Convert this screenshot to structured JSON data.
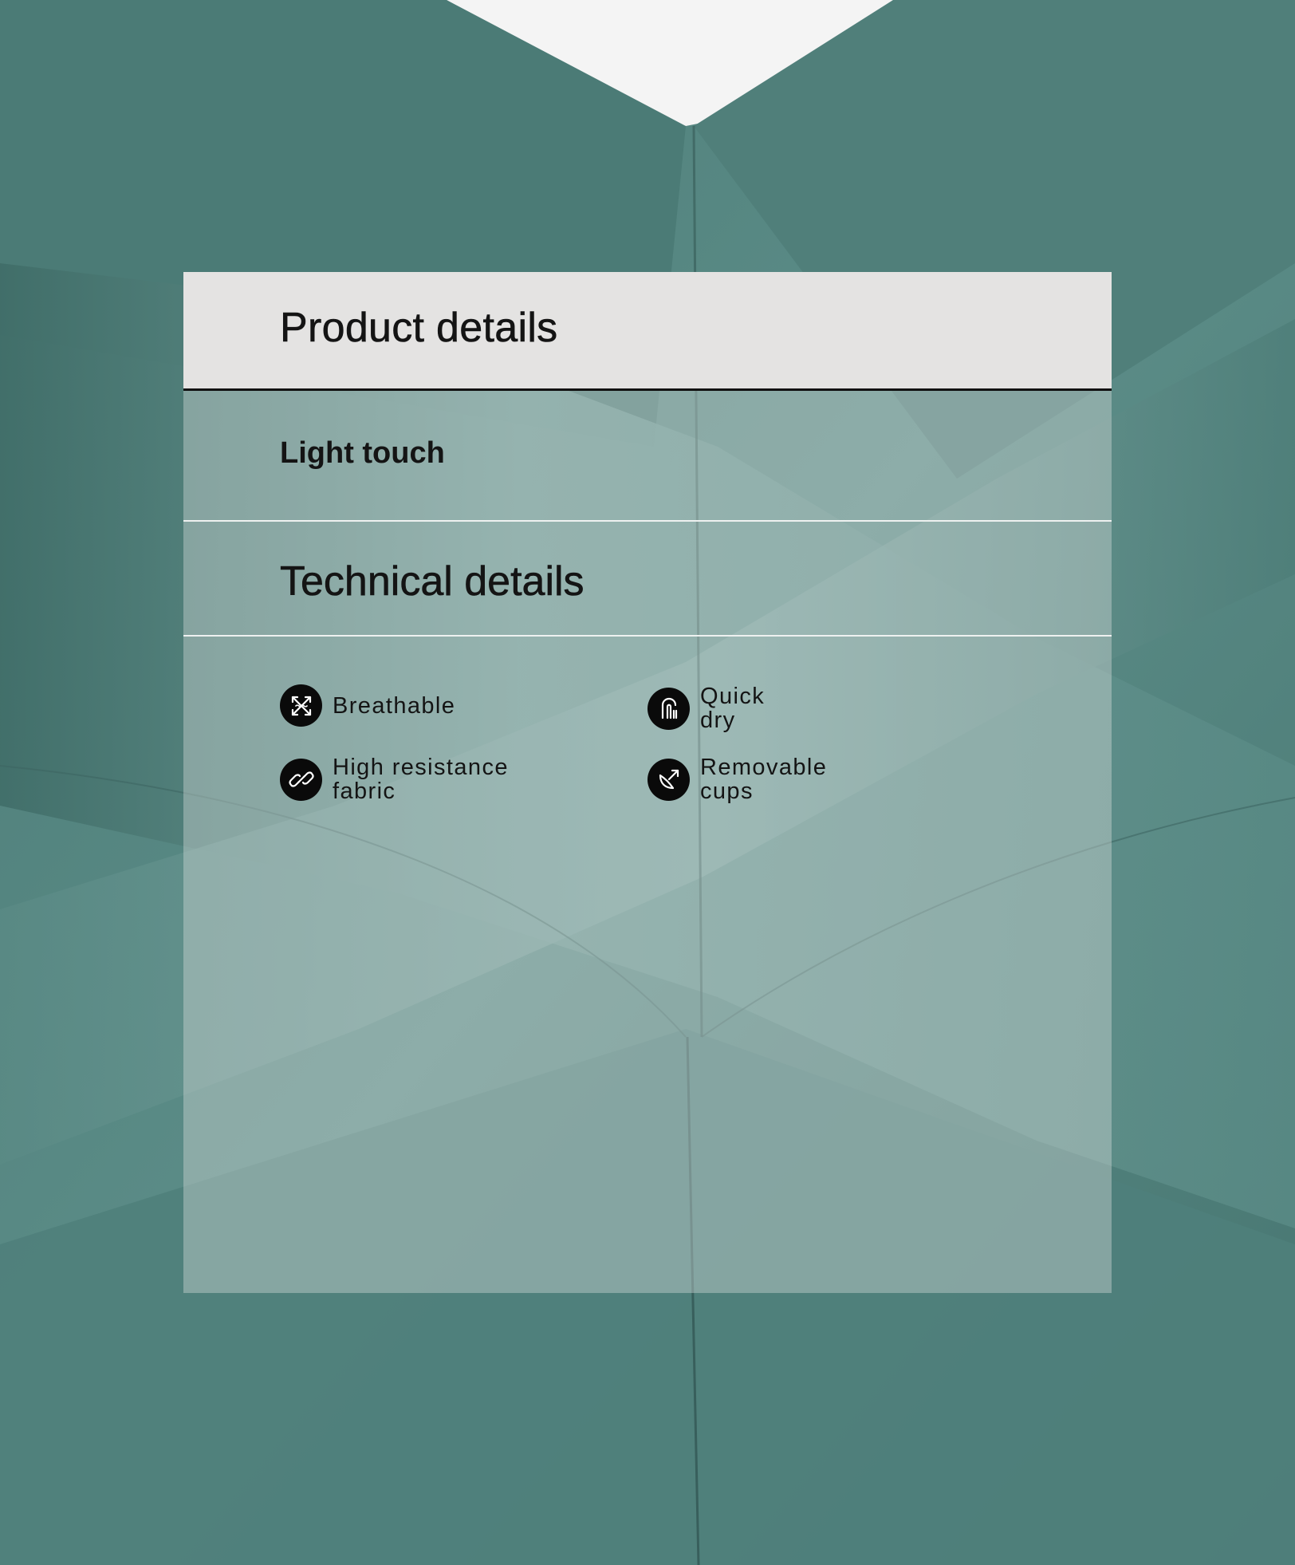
{
  "panel": {
    "title": "Product details",
    "subtitle": "Light touch",
    "section_title": "Technical details"
  },
  "features": [
    {
      "label": "Breathable",
      "icon": "breathable-arrows-icon"
    },
    {
      "label": "Quick\ndry",
      "icon": "quick-dry-icon"
    },
    {
      "label": "High resistance\nfabric",
      "icon": "chain-link-icon"
    },
    {
      "label": "Removable\ncups",
      "icon": "removable-cup-icon"
    }
  ],
  "colors": {
    "fabric": "#4e7f7a",
    "header_background": "#e4e3e2",
    "text": "#141414",
    "icon_background": "#0a0a0a"
  }
}
